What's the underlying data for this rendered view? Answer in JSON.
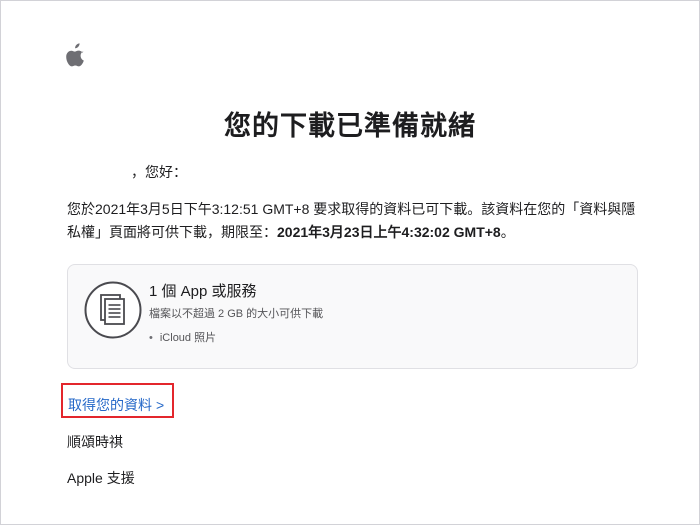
{
  "email": {
    "logo_icon": "apple-logo-icon",
    "title": "您的下載已準備就緒",
    "greeting": "，您好：",
    "paragraph": {
      "part1": "您於2021年3月5日下午3:12:51 GMT+8 要求取得的資料已可下載。該資料在您的「資料與隱私權」頁面將可供下載，期限至：",
      "deadline": "2021年3月23日上午4:32:02 GMT+8",
      "part2": "。"
    },
    "card": {
      "icon": "document-stack-icon",
      "title": "1 個 App 或服務",
      "subtitle": "檔案以不超過 2 GB 的大小可供下載",
      "items": [
        "iCloud 照片"
      ]
    },
    "link": {
      "label": "取得您的資料",
      "chevron": ">"
    },
    "signoff": "順頌時祺",
    "support": "Apple 支援",
    "colors": {
      "link": "#2568c8",
      "highlight_border": "#e3262c",
      "card_bg": "#f9f9fa"
    }
  }
}
